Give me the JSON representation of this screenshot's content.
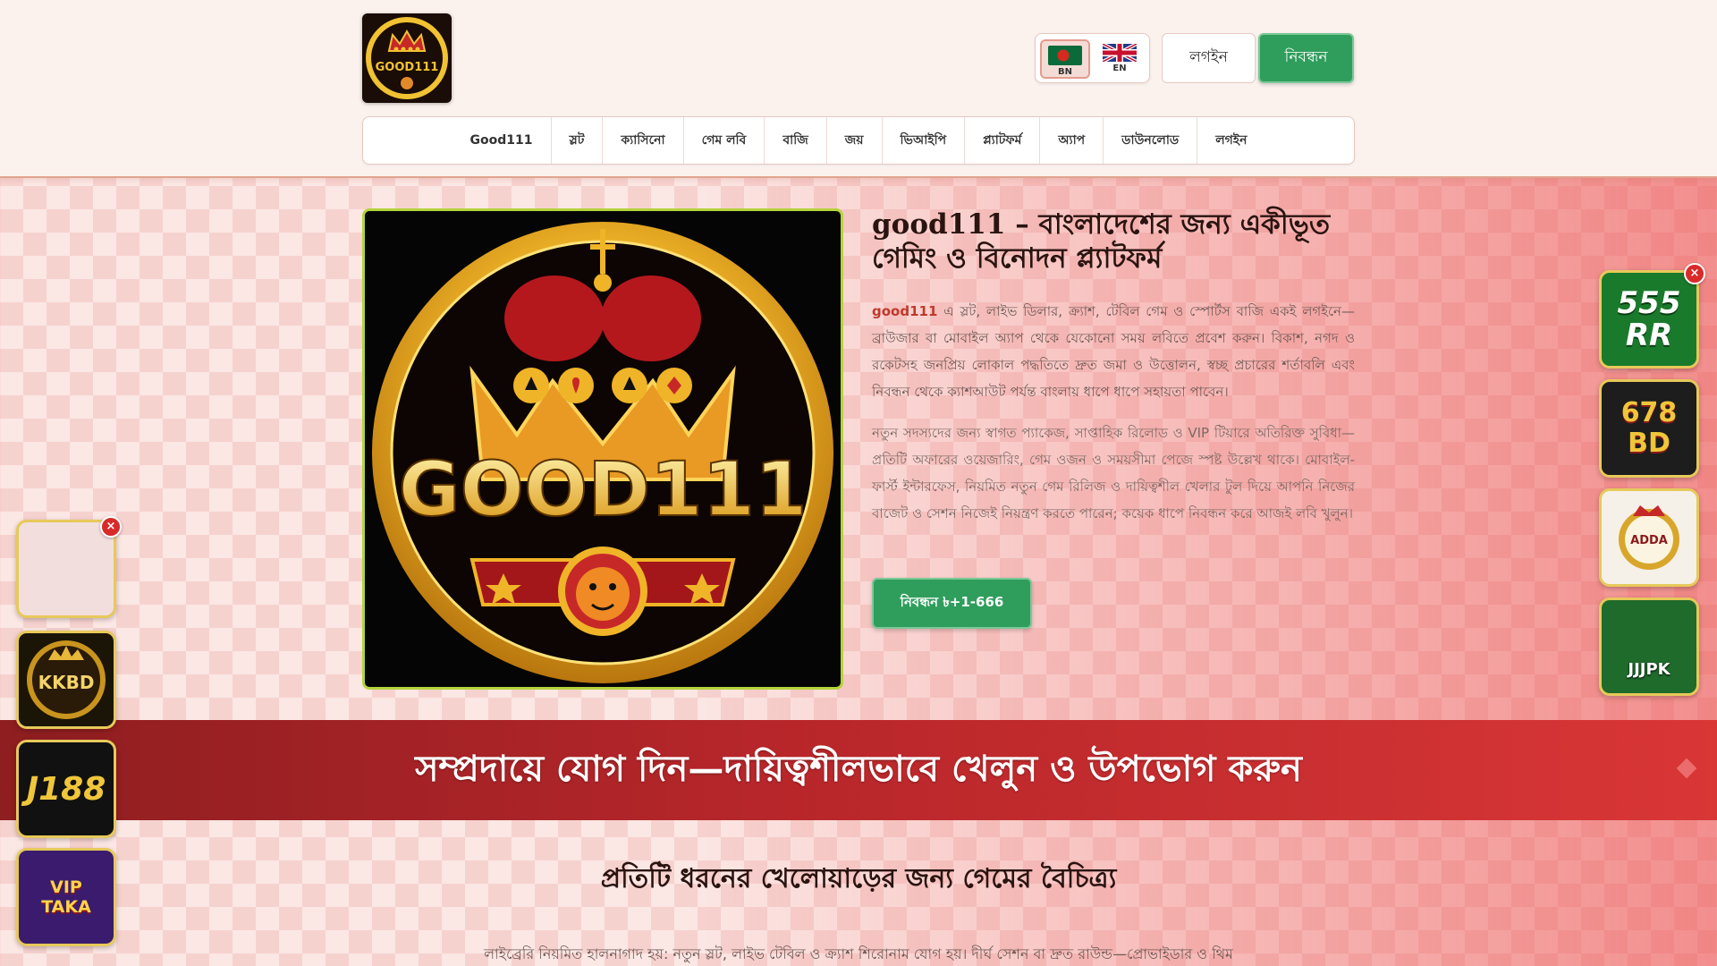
{
  "brand": {
    "logo_text": "GOOD111"
  },
  "language": {
    "bn_label": "BN",
    "en_label": "EN"
  },
  "header": {
    "login_label": "লগইন",
    "register_label": "নিবন্ধন"
  },
  "nav": {
    "items": [
      "Good111",
      "স্লট",
      "ক্যাসিনো",
      "গেম লবি",
      "বাজি",
      "জয়",
      "ভিআইপি",
      "প্ল্যাটফর্ম",
      "অ্যাপ",
      "ডাউনলোড",
      "লগইন"
    ]
  },
  "hero": {
    "image_text": "GOOD111",
    "title": "good111 – বাংলাদেশের জন্য একীভূত গেমিং ও বিনোদন প্ল্যাটফর্ম",
    "p1_brand": "good111",
    "p1_rest": " এ স্লট, লাইভ ডিলার, ক্র্যাশ, টেবিল গেম ও স্পোর্টস বাজি একই লগইনে—ব্রাউজার বা মোবাইল অ্যাপ থেকে যেকোনো সময় লবিতে প্রবেশ করুন। বিকাশ, নগদ ও রকেটসহ জনপ্রিয় লোকাল পদ্ধতিতে দ্রুত জমা ও উত্তোলন, স্বচ্ছ প্রচারের শর্তাবলি এবং নিবন্ধন থেকে ক্যাশআউট পর্যন্ত বাংলায় ধাপে ধাপে সহায়তা পাবেন।",
    "p2": "নতুন সদস্যদের জন্য স্বাগত প্যাকেজ, সাপ্তাহিক রিলোড ও VIP টিয়ারে অতিরিক্ত সুবিধা—প্রতিটি অফারের ওয়েজারিং, গেম ওজন ও সময়সীমা পেজে স্পষ্ট উল্লেখ থাকে। মোবাইল-ফার্স্ট ইন্টারফেস, নিয়মিত নতুন গেম রিলিজ ও দায়িত্বশীল খেলার টুল দিয়ে আপনি নিজের বাজেট ও সেশন নিজেই নিয়ন্ত্রণ করতে পারেন; কয়েক ধাপে নিবন্ধন করে আজই লবি খুলুন।",
    "cta_label": "নিবন্ধন ৳+1-666"
  },
  "banner": {
    "text": "সম্প্রদায়ে যোগ দিন—দায়িত্বশীলভাবে খেলুন ও উপভোগ করুন"
  },
  "section": {
    "title": "প্রতিটি ধরনের খেলোয়াড়ের জন্য গেমের বৈচিত্র্য",
    "text": "লাইব্রেরি নিয়মিত হালনাগাদ হয়: নতুন স্লট, লাইভ টেবিল ও ক্র্যাশ শিরোনাম যোগ হয়। দীর্ঘ সেশন বা দ্রুত রাউন্ড—প্রোভাইডার ও থিম"
  },
  "left_ads": [
    {
      "text": "",
      "bg": "#f3dede"
    },
    {
      "text": "KKBD",
      "bg": "#1b1508"
    },
    {
      "text": "J188",
      "bg": "#111111"
    },
    {
      "text": "VIP TAKA",
      "bg": "#3a1b6e"
    }
  ],
  "right_ads": [
    {
      "text": "555 RR",
      "bg": "#1a7a2c"
    },
    {
      "text": "678 BD",
      "bg": "#1d1d1d"
    },
    {
      "text": "ADDA",
      "bg": "#f5f0e8"
    },
    {
      "text": "JJJPK",
      "bg": "#1f6b2c"
    }
  ],
  "close_label": "×",
  "colors": {
    "accent_green": "#2f9e5c",
    "brand_red": "#c0392b",
    "banner_red": "#b7262a"
  }
}
